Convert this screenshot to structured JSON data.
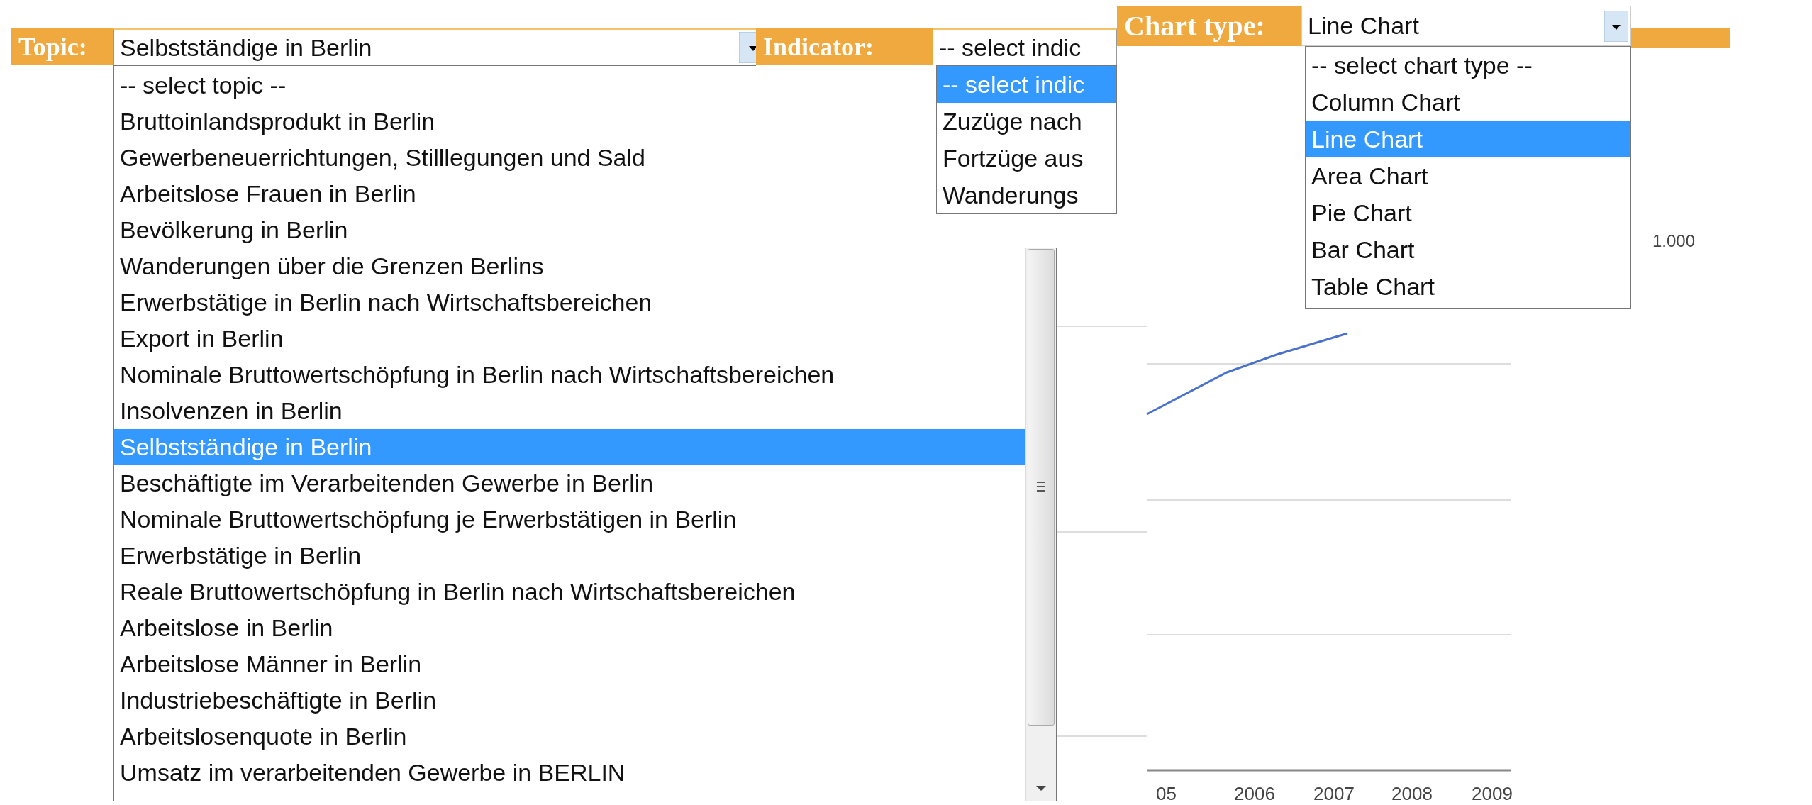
{
  "topic": {
    "label": "Topic:",
    "value": "Selbstständige in Berlin",
    "options": [
      {
        "label": "-- select topic --",
        "selected": false
      },
      {
        "label": "Bruttoinlandsprodukt in Berlin",
        "selected": false
      },
      {
        "label": "Gewerbeneuerrichtungen, Stilllegungen und Sald",
        "selected": false
      },
      {
        "label": "Arbeitslose Frauen in Berlin",
        "selected": false
      },
      {
        "label": "Bevölkerung in Berlin",
        "selected": false
      },
      {
        "label": "Wanderungen über die Grenzen Berlins",
        "selected": false
      },
      {
        "label": "Erwerbstätige in Berlin nach Wirtschaftsbereichen",
        "selected": false
      },
      {
        "label": "Export in Berlin",
        "selected": false
      },
      {
        "label": "Nominale Bruttowertschöpfung in Berlin nach Wirtschaftsbereichen",
        "selected": false
      },
      {
        "label": "Insolvenzen in Berlin",
        "selected": false
      },
      {
        "label": "Selbstständige in Berlin",
        "selected": true
      },
      {
        "label": "Beschäftigte im Verarbeitenden Gewerbe in Berlin",
        "selected": false
      },
      {
        "label": "Nominale Bruttowertschöpfung je Erwerbstätigen in Berlin",
        "selected": false
      },
      {
        "label": "Erwerbstätige in Berlin",
        "selected": false
      },
      {
        "label": "Reale Bruttowertschöpfung in Berlin nach Wirtschaftsbereichen",
        "selected": false
      },
      {
        "label": "Arbeitslose in Berlin",
        "selected": false
      },
      {
        "label": "Arbeitslose Männer in Berlin",
        "selected": false
      },
      {
        "label": "Industriebeschäftigte in Berlin",
        "selected": false
      },
      {
        "label": "Arbeitslosenquote in Berlin",
        "selected": false
      },
      {
        "label": "Umsatz im verarbeitenden Gewerbe in BERLIN",
        "selected": false
      }
    ]
  },
  "indicator": {
    "label": "Indicator:",
    "value": "-- select indic",
    "options": [
      {
        "label": "-- select indic",
        "selected": true
      },
      {
        "label": "Zuzüge nach",
        "selected": false
      },
      {
        "label": "Fortzüge aus",
        "selected": false
      },
      {
        "label": "Wanderungs",
        "selected": false
      }
    ]
  },
  "chart_type": {
    "label": "Chart type:",
    "value": "Line Chart",
    "options": [
      {
        "label": "-- select chart type --",
        "selected": false
      },
      {
        "label": "Column Chart",
        "selected": false
      },
      {
        "label": "Line Chart",
        "selected": true
      },
      {
        "label": "Area Chart",
        "selected": false
      },
      {
        "label": "Pie Chart",
        "selected": false
      },
      {
        "label": "Bar Chart",
        "selected": false
      },
      {
        "label": "Table Chart",
        "selected": false
      }
    ]
  },
  "chart": {
    "x_labels": [
      "05",
      "2006",
      "2007",
      "2008",
      "2009"
    ],
    "y_label": "1.000"
  }
}
